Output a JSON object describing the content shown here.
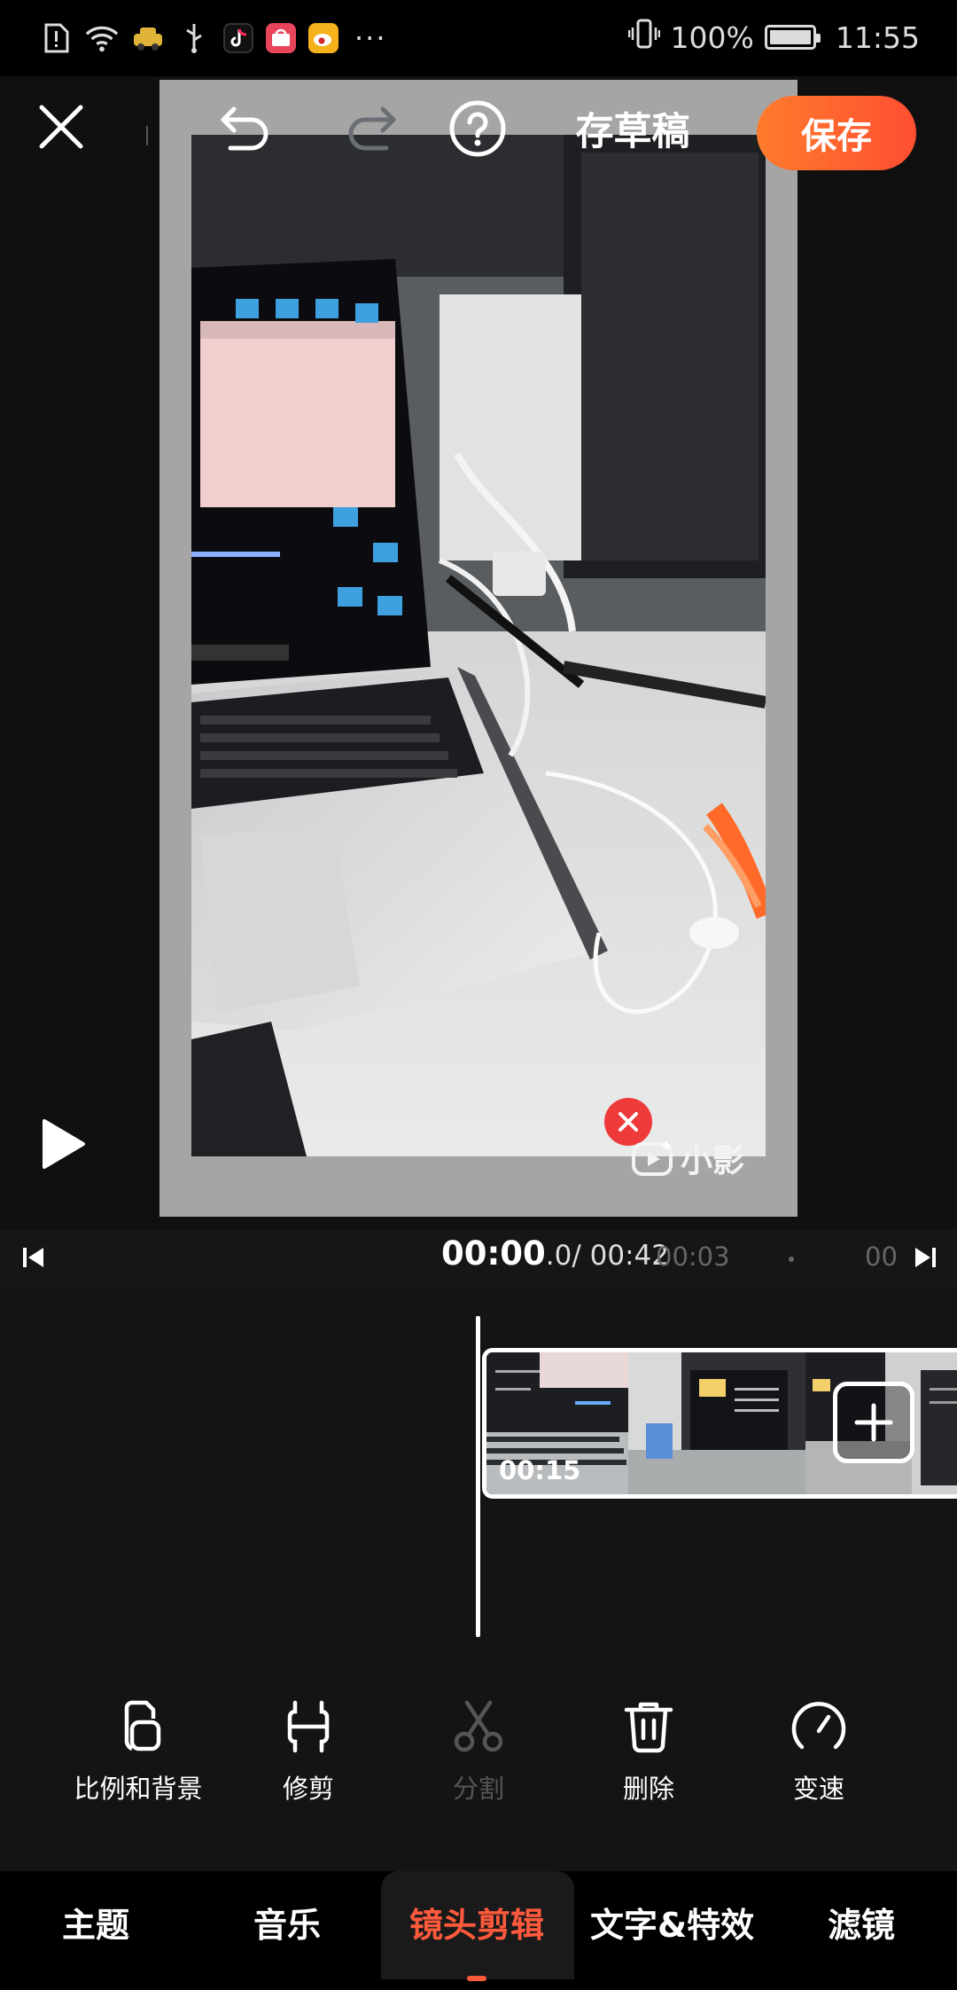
{
  "status_bar": {
    "battery": "100%",
    "time": "11:55",
    "more": "···",
    "icons": [
      "alert-sim-icon",
      "wifi-icon",
      "car-app-icon",
      "usb-icon",
      "tiktok-app-icon",
      "shopping-app-icon",
      "weibo-app-icon",
      "vibrate-icon",
      "battery-icon"
    ]
  },
  "toolbar": {
    "draft_label": "存草稿",
    "save_label": "保存"
  },
  "watermark": {
    "text": "小影"
  },
  "timeline": {
    "current_time": "00:00",
    "current_frac": ".0",
    "total_time": "/ 00:42",
    "mark_1": "00:03",
    "mark_2": "00",
    "clip_duration": "00:15"
  },
  "tools": [
    {
      "label": "比例和背景",
      "icon": "ratio-background-icon",
      "enabled": true
    },
    {
      "label": "修剪",
      "icon": "trim-icon",
      "enabled": true
    },
    {
      "label": "分割",
      "icon": "scissors-icon",
      "enabled": false
    },
    {
      "label": "删除",
      "icon": "trash-icon",
      "enabled": true
    },
    {
      "label": "变速",
      "icon": "speed-icon",
      "enabled": true
    }
  ],
  "tabs": [
    {
      "label": "主题",
      "active": false
    },
    {
      "label": "音乐",
      "active": false
    },
    {
      "label": "镜头剪辑",
      "active": true
    },
    {
      "label": "文字&特效",
      "active": false
    },
    {
      "label": "滤镜",
      "active": false
    }
  ],
  "colors": {
    "accent": "#ff5a3c",
    "save_gradient_start": "#ff7b2c",
    "save_gradient_end": "#ff4f32",
    "remove_red": "#ee3a3a"
  }
}
